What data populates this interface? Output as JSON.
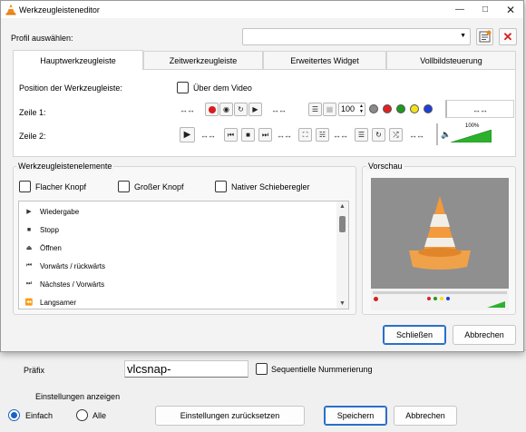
{
  "background_window": {
    "prefix_label": "Präfix",
    "prefix_value": "vlcsnap-",
    "sequential_label": "Sequentielle Nummerierung",
    "show_settings_label": "Einstellungen anzeigen",
    "simple_label": "Einfach",
    "all_label": "Alle",
    "reset_button": "Einstellungen zurücksetzen",
    "save_button": "Speichern",
    "cancel_button": "Abbrechen"
  },
  "dialog": {
    "title": "Werkzeugleisteneditor",
    "profile_label": "Profil auswählen:",
    "profile_value": "",
    "tabs": [
      "Hauptwerkzeugleiste",
      "Zeitwerkzeugleiste",
      "Erweitertes Widget",
      "Vollbildsteuerung"
    ],
    "position_label": "Position der Werkzeugleiste:",
    "above_video_label": "Über dem Video",
    "row1_label": "Zeile 1:",
    "row2_label": "Zeile 2:",
    "speed_value": "100",
    "volume_value": "100%",
    "elements_title": "Werkzeugleistenelemente",
    "flat_button_label": "Flacher Knopf",
    "big_button_label": "Großer Knopf",
    "native_slider_label": "Nativer Schieberegler",
    "elements": [
      {
        "icon": "play-icon",
        "label": "Wiedergabe"
      },
      {
        "icon": "stop-icon",
        "label": "Stopp"
      },
      {
        "icon": "eject-icon",
        "label": "Öffnen"
      },
      {
        "icon": "seek-icon",
        "label": "Vorwärts / rückwärts"
      },
      {
        "icon": "skip-icon",
        "label": "Nächstes / Vorwärts"
      },
      {
        "icon": "slower-icon",
        "label": "Langsamer"
      }
    ],
    "preview_title": "Vorschau",
    "close_button": "Schließen",
    "cancel_button": "Abbrechen"
  },
  "colors": {
    "accent": "#1a62c4",
    "cone_orange": "#f29a3c",
    "preview_bg": "#8f8f8f",
    "volume_green": "#2db12d"
  }
}
